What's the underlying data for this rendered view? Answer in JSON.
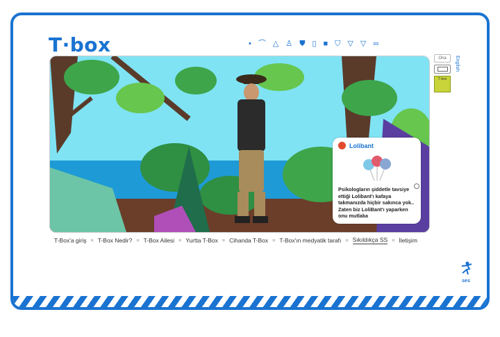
{
  "brand": {
    "logo": "T·box"
  },
  "toolbar": {
    "icons": [
      "dot-icon",
      "sock-icon",
      "triangle-icon",
      "dress-icon",
      "shirt-icon",
      "jeans-icon",
      "tank-icon",
      "jacket-icon",
      "underwear-icon",
      "briefs-icon",
      "bra-icon"
    ]
  },
  "sidebar": {
    "lang_box": "Ona",
    "english": "English",
    "tbox_mini": "T·box"
  },
  "card": {
    "title": "Lolibant",
    "text": "Psikologların şiddetle tavsiye ettiği Lolibant'ı kafaya takmanızda hiçbir sakınca yok.. Zaten biz LoliBant'ı yaparken onu mutlaka"
  },
  "nav": {
    "items": [
      "T-Box'a giriş",
      "T-Box Nedir?",
      "T-Box Ailesi",
      "Yurtta T-Box",
      "Cihanda T-Box",
      "T-Box'ın medyatik tarafı",
      "Sıkıldıkça SS",
      "İletişim"
    ],
    "active_index": 6
  },
  "sound": {
    "label": "ses"
  },
  "colors": {
    "brand_blue": "#1a73d1"
  }
}
